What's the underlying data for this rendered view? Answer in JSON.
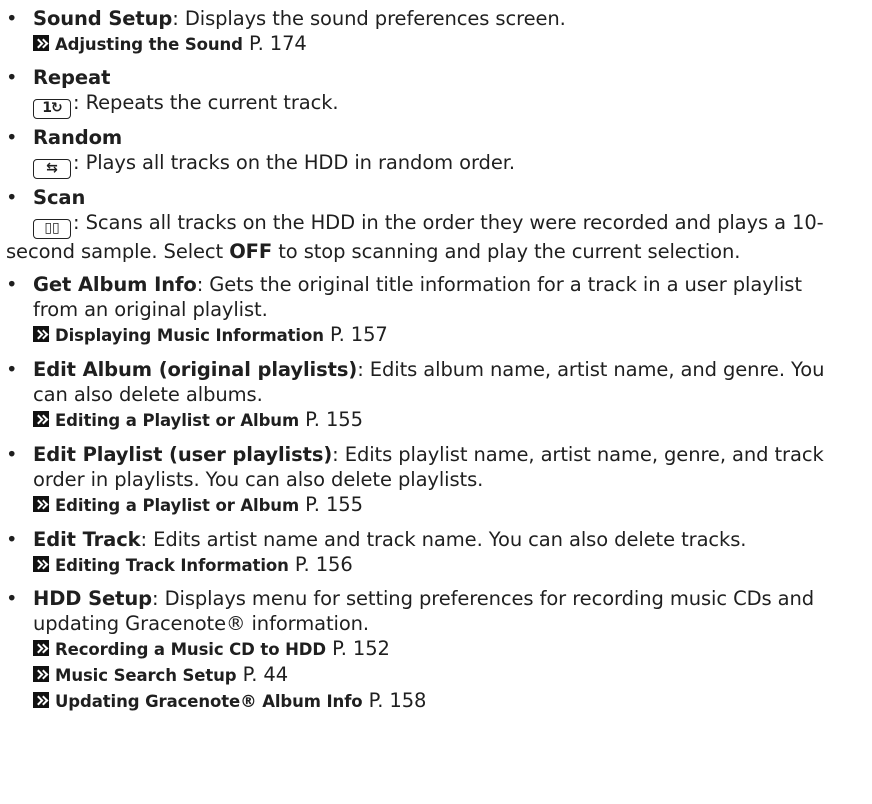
{
  "items": [
    {
      "term": "Sound Setup",
      "desc": ": Displays the sound preferences screen.",
      "refs": [
        {
          "title": "Adjusting the Sound",
          "page": " P. 174"
        }
      ]
    },
    {
      "term": "Repeat",
      "icon": "repeat-icon",
      "icon_glyph": "1↻",
      "desc": ": Repeats the current track."
    },
    {
      "term": "Random",
      "icon": "random-icon",
      "icon_glyph": "⇆",
      "desc": ": Plays all tracks on the HDD in random order."
    },
    {
      "term": "Scan",
      "icon": "scan-icon",
      "icon_glyph": "▯▯",
      "desc_line1": ": Scans all tracks on the HDD in the order they were recorded and plays a 10-",
      "desc_line2_a": "second sample. Select ",
      "desc_line2_b": "OFF",
      "desc_line2_c": " to stop scanning and play the current selection."
    },
    {
      "term": "Get Album Info",
      "desc_line1": ": Gets the original title information for a track in a user playlist",
      "desc_line2": "from an original playlist.",
      "refs": [
        {
          "title": "Displaying Music Information",
          "page": " P. 157"
        }
      ]
    },
    {
      "term": "Edit Album (original playlists)",
      "desc_line1": ": Edits album name, artist name, and genre. You",
      "desc_line2": "can also delete albums.",
      "refs": [
        {
          "title": "Editing a Playlist or Album",
          "page": " P. 155"
        }
      ]
    },
    {
      "term": "Edit Playlist (user playlists)",
      "desc_line1": ": Edits playlist name, artist name, genre, and track",
      "desc_line2": "order in playlists. You can also delete playlists.",
      "refs": [
        {
          "title": "Editing a Playlist or Album",
          "page": " P. 155"
        }
      ]
    },
    {
      "term": "Edit Track",
      "desc": ": Edits artist name and track name. You can also delete tracks.",
      "refs": [
        {
          "title": "Editing Track Information",
          "page": " P. 156"
        }
      ]
    },
    {
      "term": "HDD Setup",
      "desc_line1": ": Displays menu for setting preferences for recording music CDs and",
      "desc_line2": "updating Gracenote® information.",
      "refs": [
        {
          "title": "Recording a Music CD to HDD",
          "page": " P. 152"
        },
        {
          "title": "Music Search Setup",
          "page": " P. 44"
        },
        {
          "title": "Updating Gracenote® Album Info",
          "page": " P. 158"
        }
      ]
    }
  ],
  "bullet_char": "•"
}
